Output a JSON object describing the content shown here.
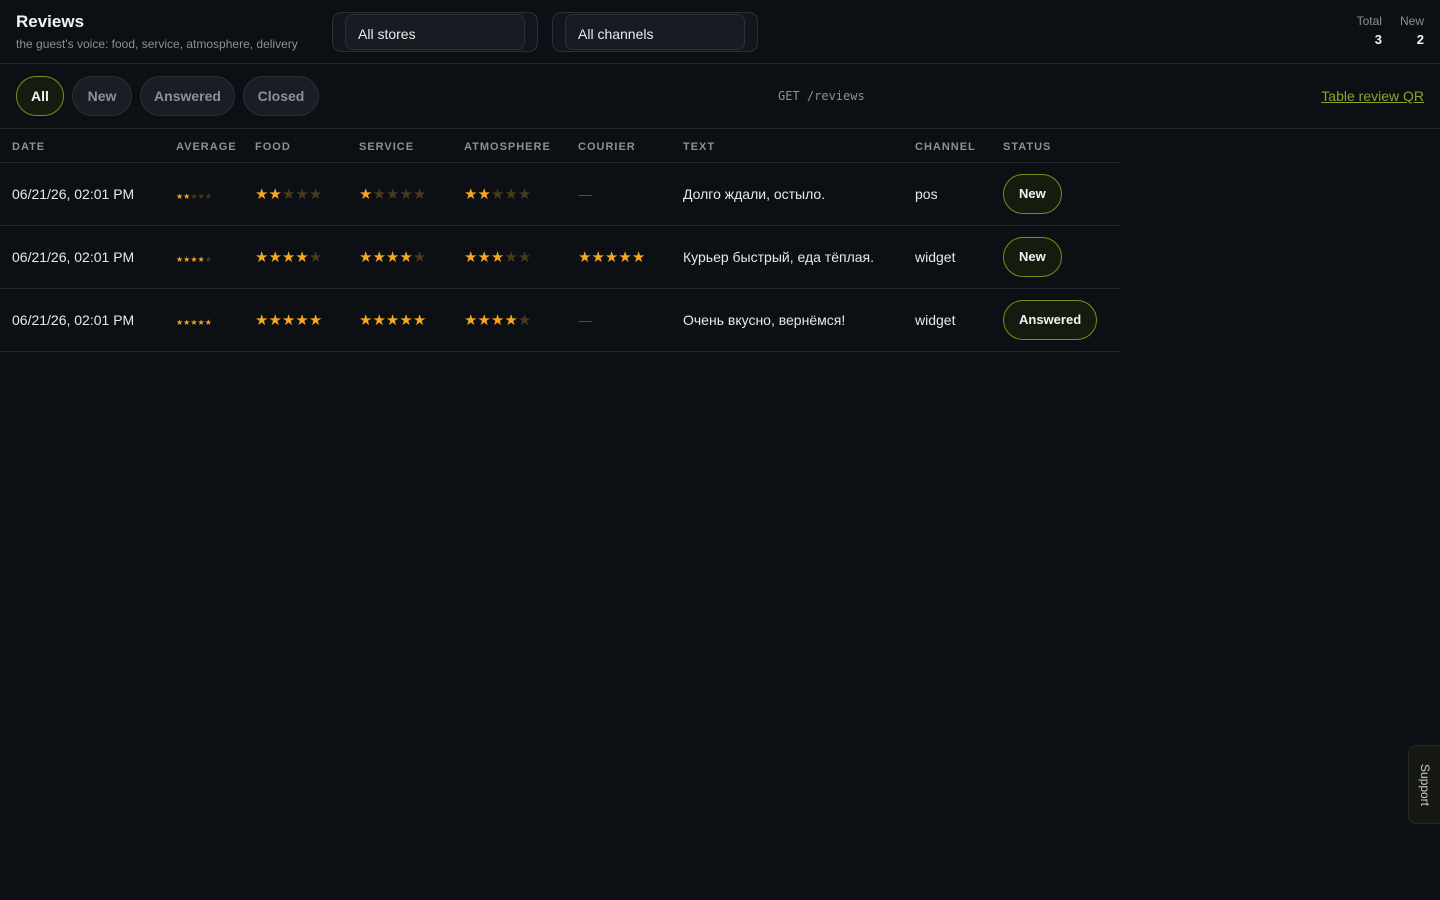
{
  "header": {
    "title": "Reviews",
    "subtitle": "the guest's voice: food, service, atmosphere, delivery",
    "store_select": "All stores",
    "channel_select": "All channels",
    "stats": {
      "total_label": "Total",
      "total_value": "3",
      "new_label": "New",
      "new_value": "2"
    }
  },
  "toolbar": {
    "filters": [
      "All",
      "New",
      "Answered",
      "Closed"
    ],
    "active_filter": "All",
    "endpoint": "GET /reviews",
    "qr_link": "Table review QR"
  },
  "table": {
    "columns": {
      "date": "DATE",
      "average": "AVERAGE",
      "food": "FOOD",
      "service": "SERVICE",
      "atmosphere": "ATMOSPHERE",
      "courier": "COURIER",
      "text": "TEXT",
      "channel": "CHANNEL",
      "status": "STATUS"
    },
    "rows": [
      {
        "date": "06/21/26, 02:01 PM",
        "average": 2,
        "food": 2,
        "service": 1,
        "atmosphere": 2,
        "courier": null,
        "courier_empty": "—",
        "text": "Долго ждали, остыло.",
        "channel": "pos",
        "status": "New"
      },
      {
        "date": "06/21/26, 02:01 PM",
        "average": 4,
        "food": 4,
        "service": 4,
        "atmosphere": 3,
        "courier": 5,
        "courier_empty": "",
        "text": "Курьер быстрый, еда тёплая.",
        "channel": "widget",
        "status": "New"
      },
      {
        "date": "06/21/26, 02:01 PM",
        "average": 5,
        "food": 5,
        "service": 5,
        "atmosphere": 4,
        "courier": null,
        "courier_empty": "—",
        "text": "Очень вкусно, вернёмся!",
        "channel": "widget",
        "status": "Answered"
      }
    ]
  },
  "support": {
    "label": "Support"
  },
  "colors": {
    "background": "#0c0f14",
    "accent": "#8aa628",
    "star_on": "#f5a623",
    "star_off": "#4a3a1c"
  }
}
